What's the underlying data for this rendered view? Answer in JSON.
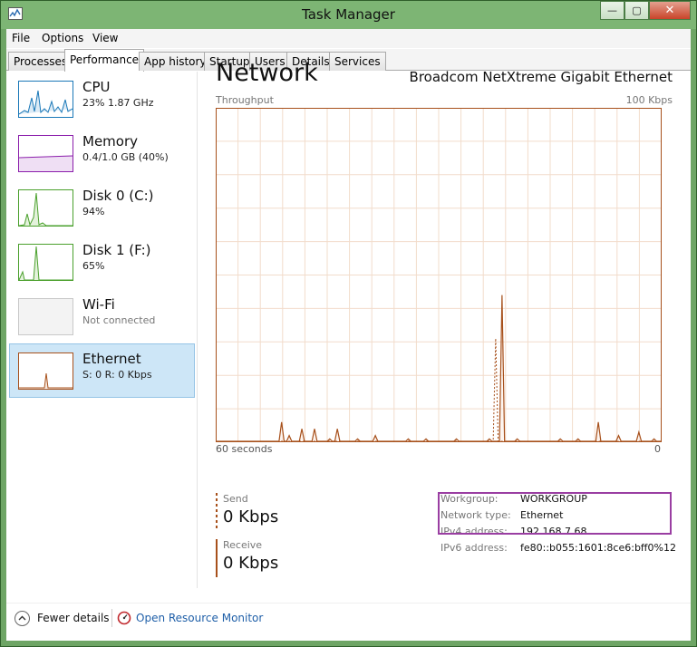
{
  "window": {
    "title": "Task Manager",
    "minimize_symbol": "—",
    "maximize_symbol": "▢",
    "close_symbol": "✕"
  },
  "menu": {
    "file": "File",
    "options": "Options",
    "view": "View"
  },
  "tabs": [
    {
      "label": "Processes"
    },
    {
      "label": "Performance",
      "active": true
    },
    {
      "label": "App history"
    },
    {
      "label": "Startup"
    },
    {
      "label": "Users"
    },
    {
      "label": "Details"
    },
    {
      "label": "Services"
    }
  ],
  "sidebar": {
    "items": [
      {
        "name": "CPU",
        "sub": "23%  1.87 GHz",
        "color": "#1a78b8",
        "icon": "cpu-thumbnail"
      },
      {
        "name": "Memory",
        "sub": "0.4/1.0 GB (40%)",
        "color": "#8b1eab",
        "icon": "memory-thumbnail"
      },
      {
        "name": "Disk 0 (C:)",
        "sub": "94%",
        "color": "#4aa02c",
        "icon": "disk-thumbnail"
      },
      {
        "name": "Disk 1 (F:)",
        "sub": "65%",
        "color": "#4aa02c",
        "icon": "disk-thumbnail"
      },
      {
        "name": "Wi-Fi",
        "sub": "Not connected",
        "color": "#aaaaaa",
        "icon": "wifi-thumbnail"
      },
      {
        "name": "Ethernet",
        "sub": "S: 0 R: 0 Kbps",
        "color": "#a7501b",
        "icon": "ethernet-thumbnail",
        "selected": true
      }
    ]
  },
  "main": {
    "title": "Network",
    "adapter": "Broadcom NetXtreme Gigabit Ethernet",
    "throughput_label": "Throughput",
    "max_label": "100 Kbps",
    "x_left": "60 seconds",
    "x_right": "0",
    "accent": "#a7501b",
    "grid_color": "#f2dccb"
  },
  "stats": {
    "send": {
      "label": "Send",
      "value": "0 Kbps"
    },
    "receive": {
      "label": "Receive",
      "value": "0 Kbps"
    }
  },
  "info": [
    {
      "key": "Workgroup:",
      "value": "WORKGROUP"
    },
    {
      "key": "Network type:",
      "value": "Ethernet"
    },
    {
      "key": "IPv4 address:",
      "value": "192.168.7.68"
    },
    {
      "key": "IPv6 address:",
      "value": "fe80::b055:1601:8ce6:bff0%12"
    }
  ],
  "highlight_color": "#9a3ea2",
  "footer": {
    "fewer_details": "Fewer details",
    "open_resource_monitor": "Open Resource Monitor"
  },
  "chart_data": {
    "type": "line",
    "series": [
      {
        "values": [
          0,
          0,
          0,
          0,
          0,
          0,
          0,
          0,
          0,
          0,
          0,
          0,
          0,
          0,
          0,
          0,
          0,
          0,
          0,
          0,
          0,
          0,
          0,
          0,
          0,
          0,
          6,
          0,
          0,
          2,
          0,
          0,
          0,
          0,
          4,
          0,
          0,
          0,
          0,
          4,
          0,
          0,
          0,
          0,
          0,
          1,
          0,
          0,
          4,
          0,
          0,
          0,
          0,
          0,
          0,
          0,
          1,
          0,
          0,
          0,
          0,
          0,
          0,
          2,
          0,
          0,
          0,
          0,
          0,
          0,
          0,
          0,
          0,
          0,
          0,
          0,
          1,
          0,
          0,
          0,
          0,
          0,
          0,
          1,
          0,
          0,
          0,
          0,
          0,
          0,
          0,
          0,
          0,
          0,
          0,
          1,
          0,
          0,
          0,
          0,
          0,
          0,
          0,
          0,
          0,
          0,
          0,
          0,
          1,
          0,
          0,
          0,
          0,
          44,
          0,
          0,
          0,
          0,
          0,
          1,
          0,
          0,
          0,
          0,
          0,
          0,
          0,
          0,
          0,
          0,
          0,
          0,
          0,
          0,
          0,
          0,
          1,
          0,
          0,
          0,
          0,
          0,
          0,
          1,
          0,
          0,
          0,
          0,
          0,
          0,
          0,
          6,
          0,
          0,
          0,
          0,
          0,
          0,
          0,
          2,
          0,
          0,
          0,
          0,
          0,
          0,
          0,
          3,
          0,
          0,
          0,
          0,
          0,
          1,
          0,
          0,
          0
        ]
      },
      {
        "values": [
          0,
          0,
          0,
          0,
          0,
          0,
          0,
          0,
          0,
          0,
          0,
          0,
          0,
          0,
          0,
          0,
          0,
          0,
          0,
          0,
          0,
          0,
          0,
          0,
          0,
          0,
          0,
          0,
          0,
          0,
          0,
          0,
          0,
          0,
          0,
          0,
          0,
          0,
          0,
          0,
          0,
          0,
          0,
          0,
          0,
          0,
          0,
          0,
          0,
          0,
          0,
          0,
          0,
          0,
          0,
          0,
          0,
          0,
          0,
          0,
          0,
          0,
          0,
          0,
          0,
          0,
          0,
          0,
          0,
          0,
          0,
          0,
          0,
          0,
          0,
          0,
          0,
          0,
          0,
          0,
          0,
          0,
          0,
          0,
          0,
          0,
          0,
          0,
          0,
          0,
          0,
          0,
          0,
          0,
          0,
          0,
          0,
          0,
          0,
          0,
          0,
          0,
          0,
          0,
          0,
          0,
          0,
          0,
          0,
          0,
          0,
          0,
          0,
          31,
          0,
          0,
          0,
          0,
          0,
          0,
          0,
          0,
          0,
          0,
          0,
          0,
          0,
          0,
          0,
          0,
          0,
          0,
          0,
          0,
          0,
          0,
          0,
          0,
          0,
          0,
          0,
          0,
          0,
          0,
          0,
          0,
          0,
          0,
          0,
          0,
          0,
          0,
          0,
          0,
          0,
          0,
          0,
          0,
          0,
          0,
          0,
          0,
          0,
          0,
          0,
          0,
          0,
          0,
          0,
          0,
          0,
          0,
          0,
          0,
          0,
          0,
          0,
          0,
          0,
          0,
          0
        ]
      }
    ],
    "xlabel": "60 seconds",
    "ylabel": "Throughput",
    "ylim": [
      0,
      100
    ],
    "grid": true
  }
}
